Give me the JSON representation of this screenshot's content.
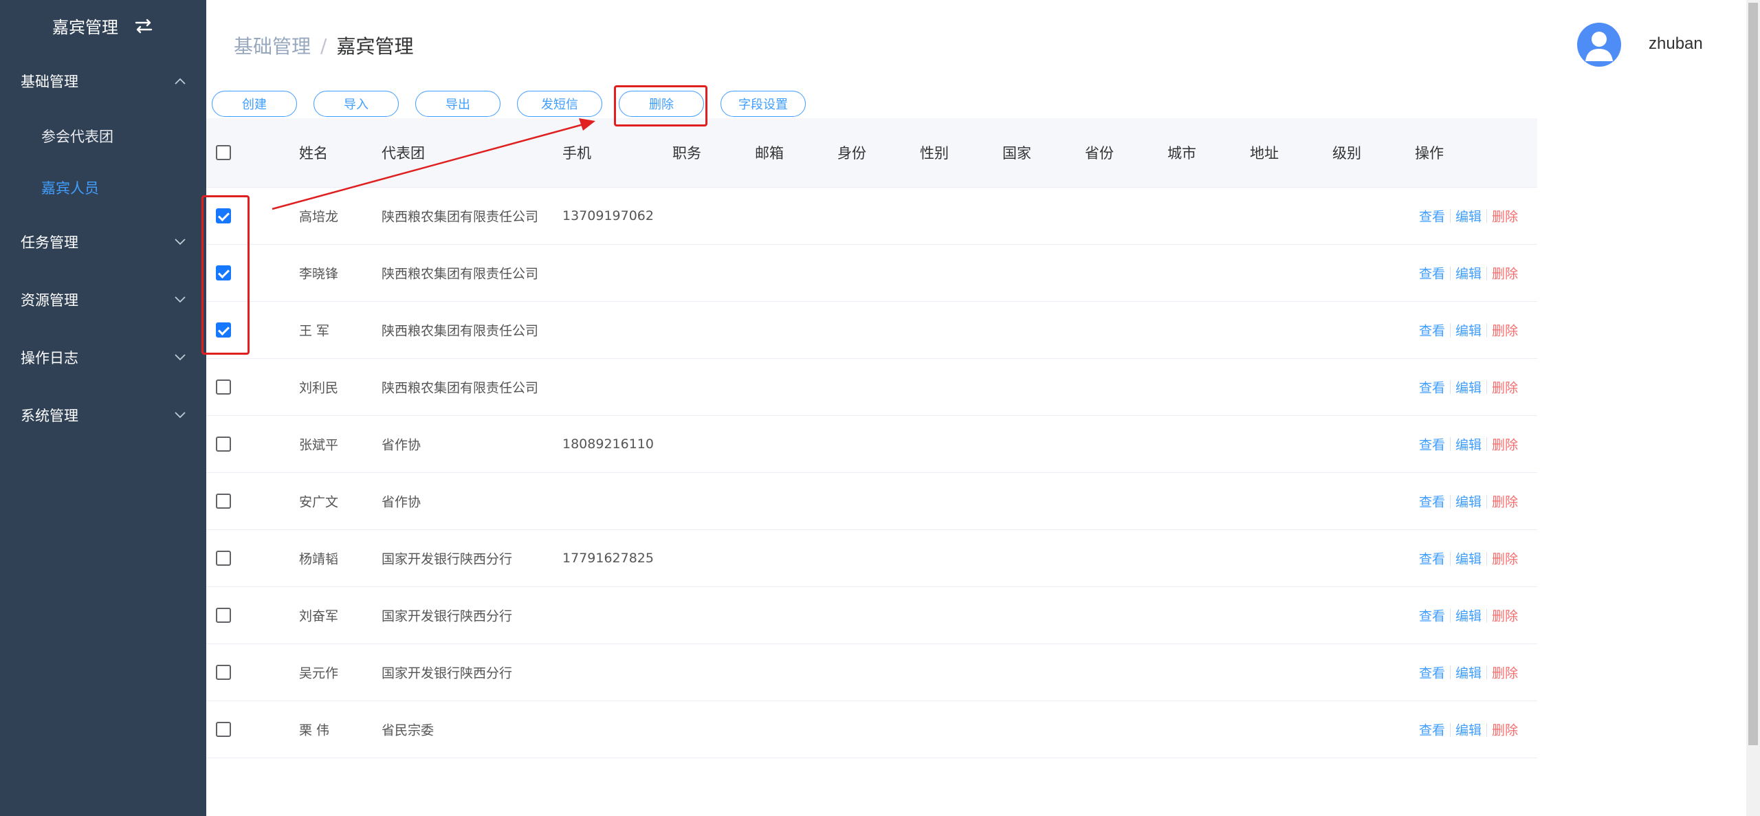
{
  "sidebar": {
    "title": "嘉宾管理",
    "groups": {
      "basic": {
        "label": "基础管理",
        "children": {
          "delegation": "参会代表团",
          "guests": "嘉宾人员"
        }
      },
      "task": {
        "label": "任务管理"
      },
      "resource": {
        "label": "资源管理"
      },
      "log": {
        "label": "操作日志"
      },
      "system": {
        "label": "系统管理"
      }
    },
    "active_item": "嘉宾人员"
  },
  "header": {
    "breadcrumb_parent": "基础管理",
    "breadcrumb_sep": "/",
    "breadcrumb_current": "嘉宾管理",
    "username": "zhuban"
  },
  "toolbar": {
    "create": "创建",
    "import": "导入",
    "export": "导出",
    "sms": "发短信",
    "delete": "删除",
    "fields": "字段设置"
  },
  "table": {
    "columns": {
      "name": "姓名",
      "delegation": "代表团",
      "phone": "手机",
      "position": "职务",
      "email": "邮箱",
      "identity": "身份",
      "gender": "性别",
      "country": "国家",
      "province": "省份",
      "city": "城市",
      "address": "地址",
      "level": "级别",
      "ops": "操作"
    },
    "actions": {
      "view": "查看",
      "edit": "编辑",
      "delete": "删除"
    },
    "rows": [
      {
        "checked": true,
        "name": "高培龙",
        "delegation": "陕西粮农集团有限责任公司",
        "phone": "13709197062"
      },
      {
        "checked": true,
        "name": "李晓锋",
        "delegation": "陕西粮农集团有限责任公司",
        "phone": ""
      },
      {
        "checked": true,
        "name": "王 军",
        "delegation": "陕西粮农集团有限责任公司",
        "phone": ""
      },
      {
        "checked": false,
        "name": "刘利民",
        "delegation": "陕西粮农集团有限责任公司",
        "phone": ""
      },
      {
        "checked": false,
        "name": "张斌平",
        "delegation": "省作协",
        "phone": "18089216110"
      },
      {
        "checked": false,
        "name": "安广文",
        "delegation": "省作协",
        "phone": ""
      },
      {
        "checked": false,
        "name": "杨靖韬",
        "delegation": "国家开发银行陕西分行",
        "phone": "17791627825"
      },
      {
        "checked": false,
        "name": "刘奋军",
        "delegation": "国家开发银行陕西分行",
        "phone": ""
      },
      {
        "checked": false,
        "name": "吴元作",
        "delegation": "国家开发银行陕西分行",
        "phone": ""
      },
      {
        "checked": false,
        "name": "栗 伟",
        "delegation": "省民宗委",
        "phone": ""
      }
    ]
  },
  "colors": {
    "sidebar_bg": "#304156",
    "accent": "#409eff",
    "danger": "#f56c6c",
    "annotation": "#e02020",
    "checkbox_checked": "#1677ff"
  }
}
